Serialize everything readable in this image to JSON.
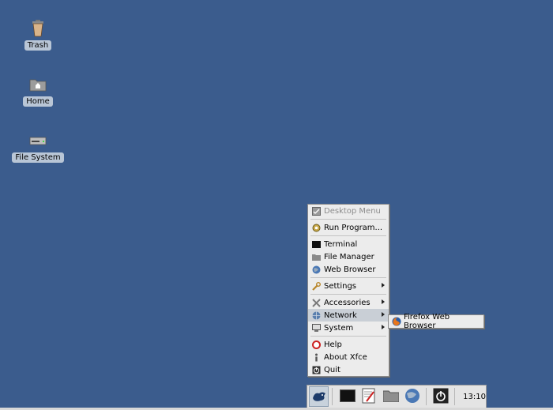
{
  "desktop": {
    "background_color": "#3b5c8d",
    "icons": [
      {
        "label": "Trash",
        "icon": "trash-icon"
      },
      {
        "label": "Home",
        "icon": "home-folder-icon"
      },
      {
        "label": "File System",
        "icon": "drive-icon"
      }
    ]
  },
  "menu": {
    "items": [
      {
        "label": "Desktop Menu",
        "icon": "desktop-menu-icon",
        "disabled": true
      },
      {
        "label": "Run Program...",
        "icon": "run-icon"
      },
      {
        "label": "Terminal",
        "icon": "terminal-icon"
      },
      {
        "label": "File Manager",
        "icon": "folder-icon"
      },
      {
        "label": "Web Browser",
        "icon": "globe-icon"
      },
      {
        "label": "Settings",
        "icon": "wrench-icon",
        "submenu": true
      },
      {
        "label": "Accessories",
        "icon": "tools-icon",
        "submenu": true
      },
      {
        "label": "Network",
        "icon": "network-icon",
        "submenu": true,
        "active": true
      },
      {
        "label": "System",
        "icon": "system-icon",
        "submenu": true
      },
      {
        "label": "Help",
        "icon": "help-icon"
      },
      {
        "label": "About Xfce",
        "icon": "info-icon"
      },
      {
        "label": "Quit",
        "icon": "quit-icon"
      }
    ]
  },
  "submenu": {
    "network_items": [
      {
        "label": "Firefox Web Browser",
        "icon": "firefox-icon"
      }
    ]
  },
  "panel": {
    "launchers": [
      "xfce-mouse-icon",
      "terminal-icon",
      "text-editor-icon",
      "file-manager-icon",
      "web-browser-icon",
      "power-icon"
    ],
    "clock": "13:10"
  }
}
